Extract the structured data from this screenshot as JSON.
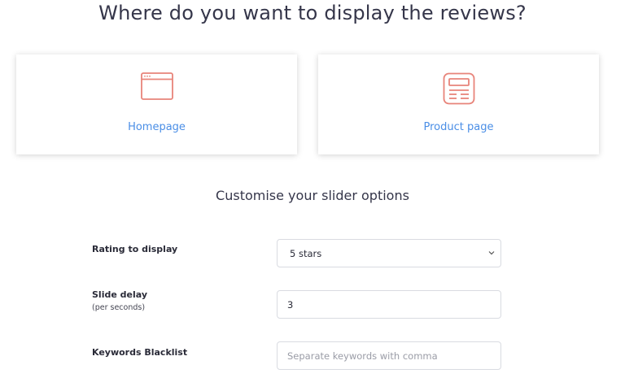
{
  "header": {
    "title": "Where do you want to display the reviews?"
  },
  "placement_cards": [
    {
      "label": "Homepage",
      "icon": "browser-window-icon"
    },
    {
      "label": "Product page",
      "icon": "product-page-icon"
    }
  ],
  "options": {
    "title": "Customise your slider options",
    "rating": {
      "label": "Rating to display",
      "selected": "5 stars"
    },
    "slide_delay": {
      "label": "Slide delay",
      "sublabel": "(per seconds)",
      "value": "3"
    },
    "blacklist": {
      "label": "Keywords Blacklist",
      "value": "",
      "placeholder": "Separate keywords with comma"
    }
  },
  "colors": {
    "accent_blue": "#4a8ee6",
    "icon_salmon": "#e8847a",
    "text_dark": "#35364a",
    "border": "#d9dbe1"
  }
}
